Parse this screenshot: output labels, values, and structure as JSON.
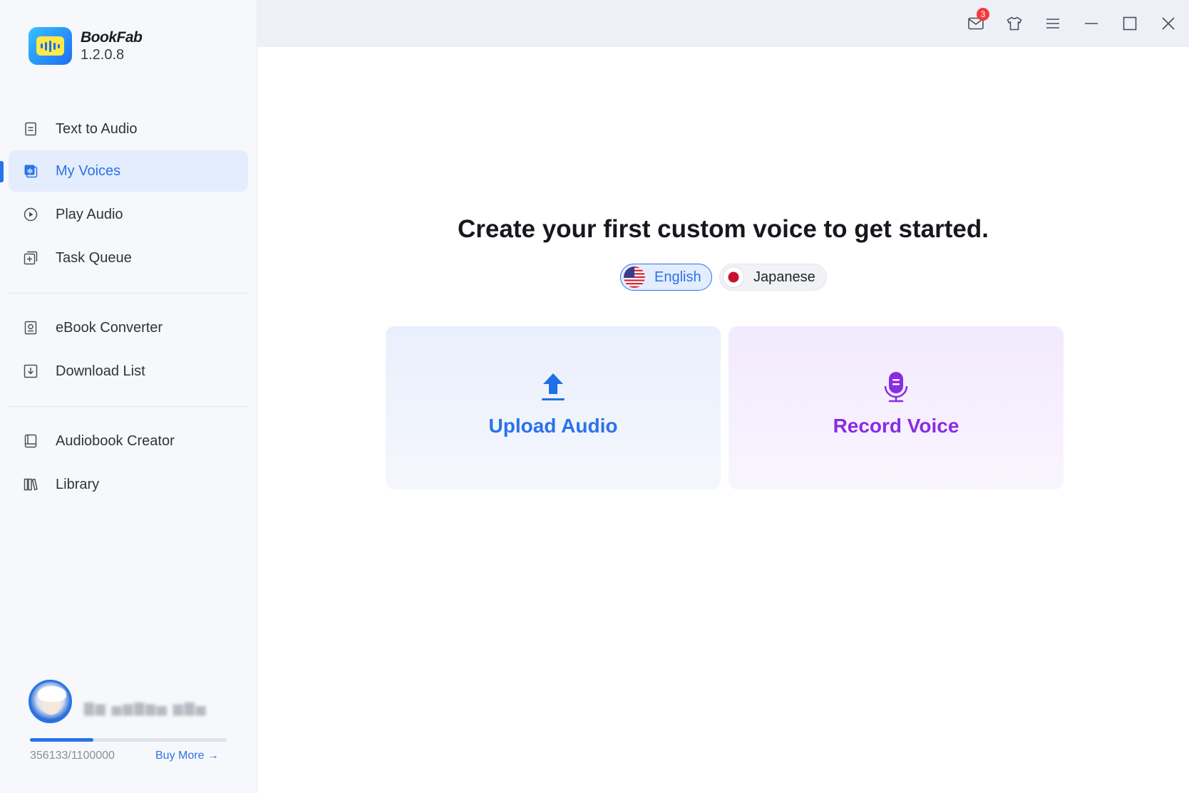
{
  "app": {
    "name": "BookFab",
    "version": "1.2.0.8"
  },
  "sidebar": {
    "items": [
      {
        "label": "Text to Audio",
        "icon": "document-icon"
      },
      {
        "label": "My Voices",
        "icon": "voice-icon",
        "active": true
      },
      {
        "label": "Play Audio",
        "icon": "play-circle-icon"
      },
      {
        "label": "Task Queue",
        "icon": "queue-icon"
      },
      {
        "label": "eBook Converter",
        "icon": "ebook-icon"
      },
      {
        "label": "Download List",
        "icon": "download-icon"
      },
      {
        "label": "Audiobook Creator",
        "icon": "audiobook-icon"
      },
      {
        "label": "Library",
        "icon": "library-icon"
      }
    ],
    "user": {
      "quota_used": 356133,
      "quota_total": 1100000,
      "quota_text": "356133/1100000",
      "buy_more_label": "Buy More →"
    }
  },
  "titlebar": {
    "mail_badge_count": "3"
  },
  "main": {
    "headline": "Create your first custom voice to get started.",
    "languages": [
      {
        "label": "English",
        "selected": true
      },
      {
        "label": "Japanese",
        "selected": false
      }
    ],
    "cards": {
      "upload_label": "Upload Audio",
      "record_label": "Record Voice"
    }
  },
  "colors": {
    "accent": "#2a72ea",
    "record_accent": "#8b2be2",
    "badge": "#f23b3b"
  }
}
